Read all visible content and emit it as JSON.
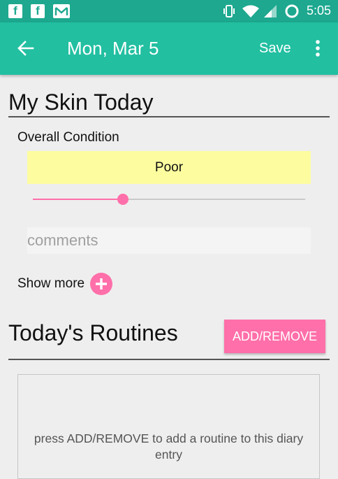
{
  "status_bar": {
    "time": "5:05",
    "icons": [
      "facebook-icon",
      "facebook-icon",
      "gmail-icon",
      "vibrate-icon",
      "wifi-icon",
      "signal-icon",
      "sync-icon"
    ]
  },
  "app_bar": {
    "title": "Mon, Mar 5",
    "save_label": "Save",
    "back_icon": "arrow-left-icon",
    "menu_icon": "more-vertical-icon"
  },
  "skin_section": {
    "title": "My Skin Today",
    "overall_label": "Overall Condition",
    "condition_value": "Poor",
    "slider_fraction": 0.33,
    "comments_placeholder": "comments",
    "comments_value": "",
    "show_more_label": "Show more"
  },
  "routines_section": {
    "title": "Today's Routines",
    "add_remove_label": "ADD/REMOVE",
    "empty_hint": "press ADD/REMOVE to add a routine to this diary entry"
  },
  "colors": {
    "status_bar": "#1da88f",
    "app_bar": "#22bfa1",
    "accent_pink": "#ff6fa9",
    "condition_bg": "#fdfda0",
    "background": "#eeeeee"
  }
}
